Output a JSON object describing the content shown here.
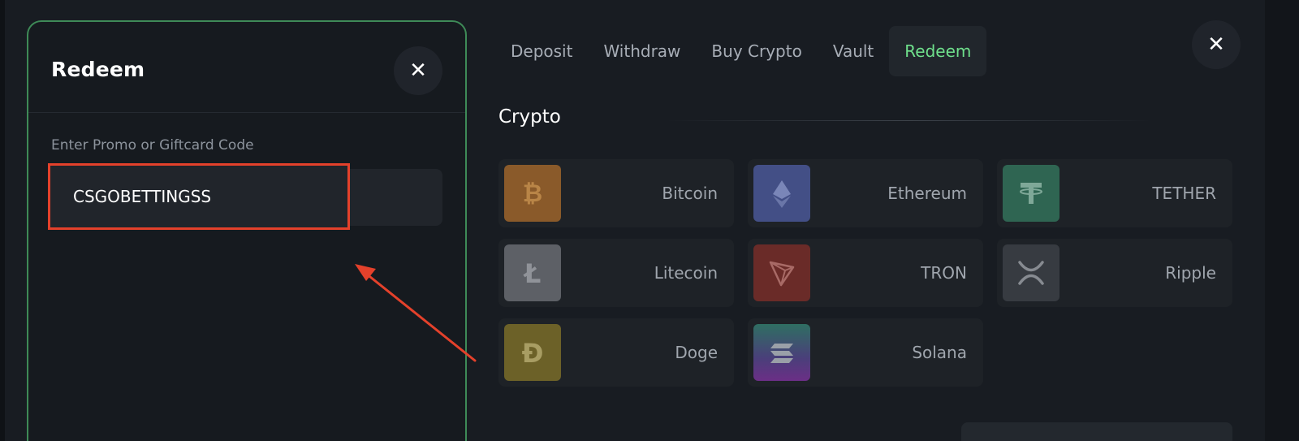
{
  "redeem_panel": {
    "title": "Redeem",
    "field_label": "Enter Promo or Giftcard Code",
    "code_value": "CSGOBETTINGSS",
    "border_color": "#3e8a57"
  },
  "tabs": [
    {
      "label": "Deposit",
      "active": false
    },
    {
      "label": "Withdraw",
      "active": false
    },
    {
      "label": "Buy Crypto",
      "active": false
    },
    {
      "label": "Vault",
      "active": false
    },
    {
      "label": "Redeem",
      "active": true
    }
  ],
  "section": {
    "title": "Crypto"
  },
  "cryptos": [
    {
      "name": "Bitcoin",
      "icon": "bitcoin-icon",
      "color": "#8a5a2a"
    },
    {
      "name": "Ethereum",
      "icon": "ethereum-icon",
      "color": "#434f86"
    },
    {
      "name": "TETHER",
      "icon": "tether-icon",
      "color": "#2f6552"
    },
    {
      "name": "Litecoin",
      "icon": "litecoin-icon",
      "color": "#5d6066"
    },
    {
      "name": "TRON",
      "icon": "tron-icon",
      "color": "#6a2b28"
    },
    {
      "name": "Ripple",
      "icon": "ripple-icon",
      "color": "#373b41"
    },
    {
      "name": "Doge",
      "icon": "doge-icon",
      "color": "#6c6128"
    },
    {
      "name": "Solana",
      "icon": "solana-icon",
      "color": "#3a5a5a"
    }
  ],
  "annotation": {
    "highlight_color": "#e4412b"
  },
  "colors": {
    "accent": "#6fe08c",
    "background": "#181c22",
    "card": "#1e2227"
  }
}
